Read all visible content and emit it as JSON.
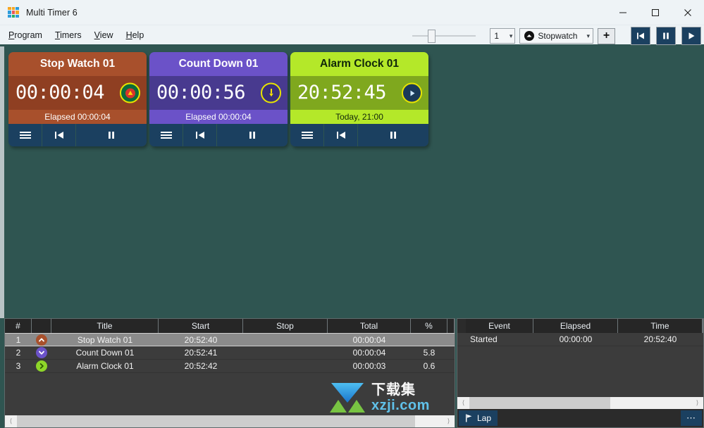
{
  "window": {
    "title": "Multi Timer 6",
    "app_icon": "grid-squares-icon",
    "minimize_label": "–",
    "maximize_label": "□",
    "close_label": "✕"
  },
  "menu": {
    "items": [
      {
        "label": "Program",
        "accel": "P"
      },
      {
        "label": "Timers",
        "accel": "T"
      },
      {
        "label": "View",
        "accel": "V"
      },
      {
        "label": "Help",
        "accel": "H"
      }
    ]
  },
  "toolbar": {
    "zoom_slider_value": 22,
    "count_combo_value": "1",
    "type_combo_value": "Stopwatch",
    "type_combo_icon": "stopwatch-circle-icon",
    "add_button_label": "+",
    "reset_button_icon": "skip-back-icon",
    "pause_button_icon": "pause-icon",
    "play_button_icon": "play-icon"
  },
  "cards": [
    {
      "title": "Stop Watch 01",
      "display": "00:00:04",
      "subtitle": "Elapsed 00:00:04",
      "badge_icon": "up-triangle-icon",
      "colors": {
        "header": "#a8502c",
        "body": "#8f3f22",
        "sub": "#a8502c",
        "badge_bg": "#0c6b3c",
        "title_text": "#ffffff",
        "sub_text": "#ffffff"
      },
      "buttons": [
        "menu-icon",
        "skip-back-icon",
        "pause-icon"
      ]
    },
    {
      "title": "Count Down 01",
      "display": "00:00:56",
      "subtitle": "Elapsed 00:00:04",
      "badge_icon": "down-arrow-icon",
      "colors": {
        "header": "#6b52c8",
        "body": "#483a8f",
        "sub": "#6b52c8",
        "badge_bg": "#3a2f7a",
        "title_text": "#ffffff",
        "sub_text": "#ffffff"
      },
      "buttons": [
        "menu-icon",
        "skip-back-icon",
        "pause-icon"
      ]
    },
    {
      "title": "Alarm Clock 01",
      "display": "20:52:45",
      "subtitle": "Today, 21:00",
      "badge_icon": "play-icon",
      "colors": {
        "header": "#b4e829",
        "body": "#7fa81e",
        "sub": "#b4e829",
        "badge_bg": "#1b3a58",
        "title_text": "#10260a",
        "sub_text": "#10260a"
      },
      "buttons": [
        "menu-icon",
        "skip-back-icon",
        "pause-icon"
      ]
    }
  ],
  "timer_table": {
    "columns": [
      "#",
      "",
      "Title",
      "Start",
      "Stop",
      "Total",
      "%",
      ""
    ],
    "rows": [
      {
        "num": "1",
        "icon": "up-chevron-circle-icon",
        "icon_color": "#a8502c",
        "title": "Stop Watch 01",
        "start": "20:52:40",
        "stop": "",
        "total": "00:00:04",
        "pct": "",
        "selected": true
      },
      {
        "num": "2",
        "icon": "down-chevron-circle-icon",
        "icon_color": "#6b52c8",
        "title": "Count Down 01",
        "start": "20:52:41",
        "stop": "",
        "total": "00:00:04",
        "pct": "5.8",
        "selected": false
      },
      {
        "num": "3",
        "icon": "right-chevron-circle-icon",
        "icon_color": "#8ed629",
        "title": "Alarm Clock 01",
        "start": "20:52:42",
        "stop": "",
        "total": "00:00:03",
        "pct": "0.6",
        "selected": false
      }
    ]
  },
  "event_table": {
    "columns": [
      "Event",
      "Elapsed",
      "Time"
    ],
    "rows": [
      {
        "event": "Started",
        "elapsed": "00:00:00",
        "time": "20:52:40"
      }
    ]
  },
  "footer": {
    "lap_label": "Lap",
    "lap_icon": "flag-icon",
    "more_label": "⋯",
    "more_icon": "ellipsis-icon"
  },
  "watermark": {
    "cn": "下载集",
    "en": "xzji.com",
    "icon": "download-arrow-icon"
  },
  "colors": {
    "desktop_bg": "#2f5551",
    "chrome_bg": "#eef3f6",
    "accent_blue": "#1b4060",
    "grid_bg": "#3c3c3c",
    "grid_header_bg": "#262626",
    "selection": "#8b8b8b"
  }
}
